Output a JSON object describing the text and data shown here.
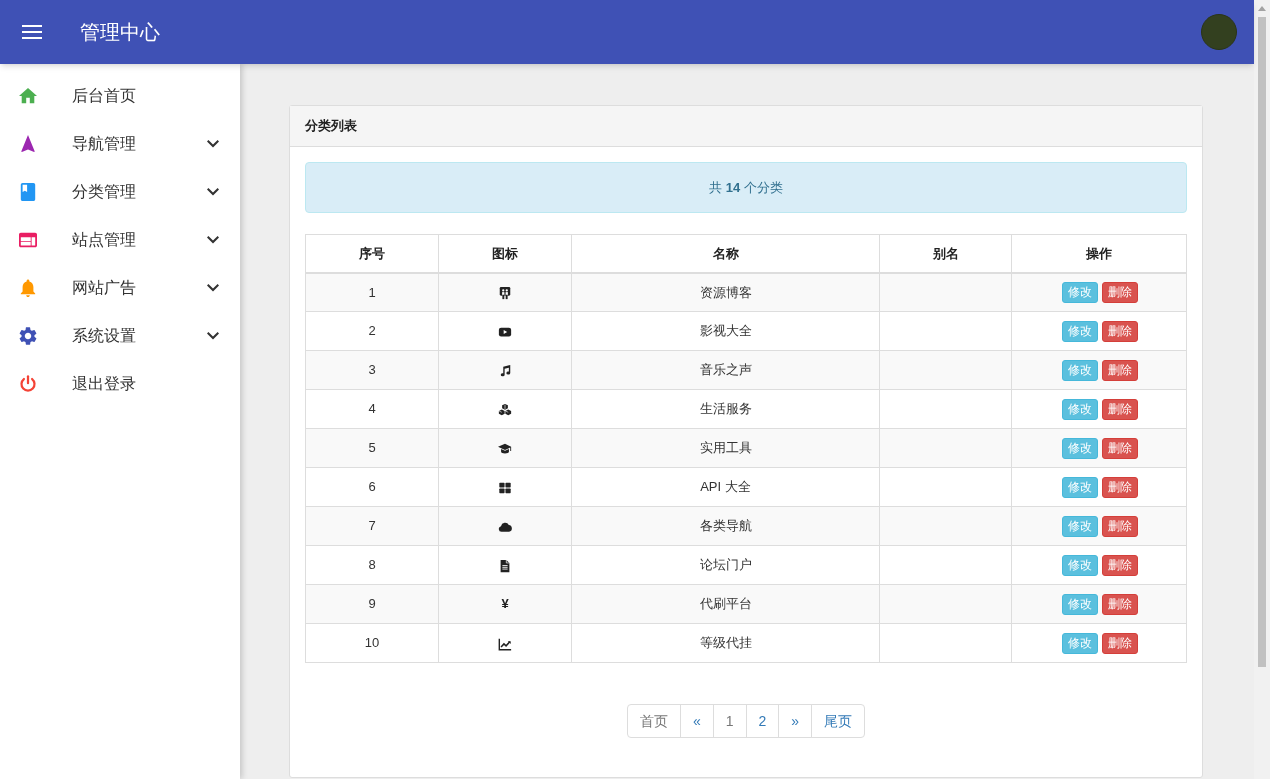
{
  "header": {
    "title": "管理中心"
  },
  "sidebar": {
    "items": [
      {
        "label": "后台首页",
        "kind": "link"
      },
      {
        "label": "导航管理",
        "kind": "menu"
      },
      {
        "label": "分类管理",
        "kind": "menu"
      },
      {
        "label": "站点管理",
        "kind": "menu"
      },
      {
        "label": "网站广告",
        "kind": "menu"
      },
      {
        "label": "系统设置",
        "kind": "menu"
      },
      {
        "label": "退出登录",
        "kind": "link"
      }
    ]
  },
  "panel": {
    "title": "分类列表",
    "summary": "共 **14** 个分类",
    "table": {
      "columns": [
        "序号",
        "图标",
        "名称",
        "别名",
        "操作"
      ],
      "rows": [
        {
          "number": "1",
          "name": "资源博客",
          "actions": [
            "修改",
            "删除"
          ]
        },
        {
          "number": "2",
          "name": "影视大全",
          "actions": [
            "修改",
            "删除"
          ]
        },
        {
          "number": "3",
          "name": "音乐之声",
          "actions": [
            "修改",
            "删除"
          ]
        },
        {
          "number": "4",
          "name": "生活服务",
          "actions": [
            "修改",
            "删除"
          ]
        },
        {
          "number": "5",
          "name": "实用工具",
          "actions": [
            "修改",
            "删除"
          ]
        },
        {
          "number": "6",
          "name": "API 大全",
          "actions": [
            "修改",
            "删除"
          ]
        },
        {
          "number": "7",
          "name": "各类导航",
          "actions": [
            "修改",
            "删除"
          ]
        },
        {
          "number": "8",
          "name": "论坛门户",
          "actions": [
            "修改",
            "删除"
          ]
        },
        {
          "number": "9",
          "icon_glyph": "¥",
          "name": "代刷平台",
          "actions": [
            "修改",
            "删除"
          ]
        },
        {
          "number": "10",
          "name": "等级代挂",
          "actions": [
            "修改",
            "删除"
          ]
        }
      ]
    },
    "pagination": [
      {
        "label": "首页",
        "disabled": true
      },
      {
        "label": "«",
        "disabled": false
      },
      {
        "label": "1",
        "disabled": true
      },
      {
        "label": "2",
        "disabled": false
      },
      {
        "label": "»",
        "disabled": false
      },
      {
        "label": "尾页",
        "disabled": false
      }
    ]
  }
}
